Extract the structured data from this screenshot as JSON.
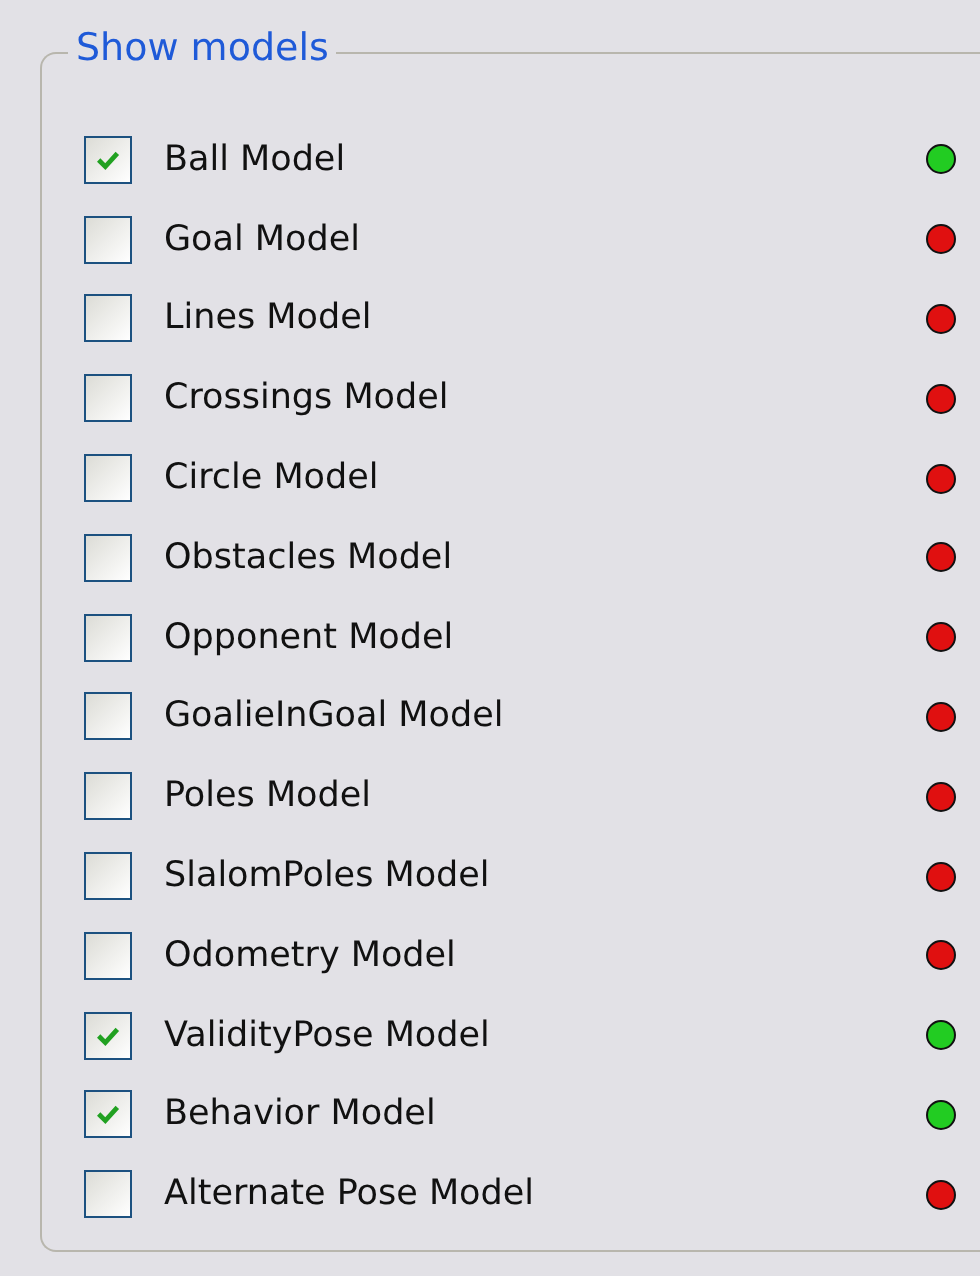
{
  "group": {
    "title": "Show models"
  },
  "models": [
    {
      "label": "Ball Model",
      "checked": true,
      "color": "#22cc22"
    },
    {
      "label": "Goal Model",
      "checked": false,
      "color": "#e01010"
    },
    {
      "label": "Lines Model",
      "checked": false,
      "color": "#e01010"
    },
    {
      "label": "Crossings Model",
      "checked": false,
      "color": "#e01010"
    },
    {
      "label": "Circle Model",
      "checked": false,
      "color": "#e01010"
    },
    {
      "label": "Obstacles Model",
      "checked": false,
      "color": "#e01010"
    },
    {
      "label": "Opponent Model",
      "checked": false,
      "color": "#e01010"
    },
    {
      "label": "GoalieInGoal Model",
      "checked": false,
      "color": "#e01010"
    },
    {
      "label": "Poles Model",
      "checked": false,
      "color": "#e01010"
    },
    {
      "label": "SlalomPoles Model",
      "checked": false,
      "color": "#e01010"
    },
    {
      "label": "Odometry Model",
      "checked": false,
      "color": "#e01010"
    },
    {
      "label": "ValidityPose Model",
      "checked": true,
      "color": "#22cc22"
    },
    {
      "label": "Behavior Model",
      "checked": true,
      "color": "#22cc22"
    },
    {
      "label": "Alternate Pose Model",
      "checked": false,
      "color": "#e01010"
    }
  ]
}
